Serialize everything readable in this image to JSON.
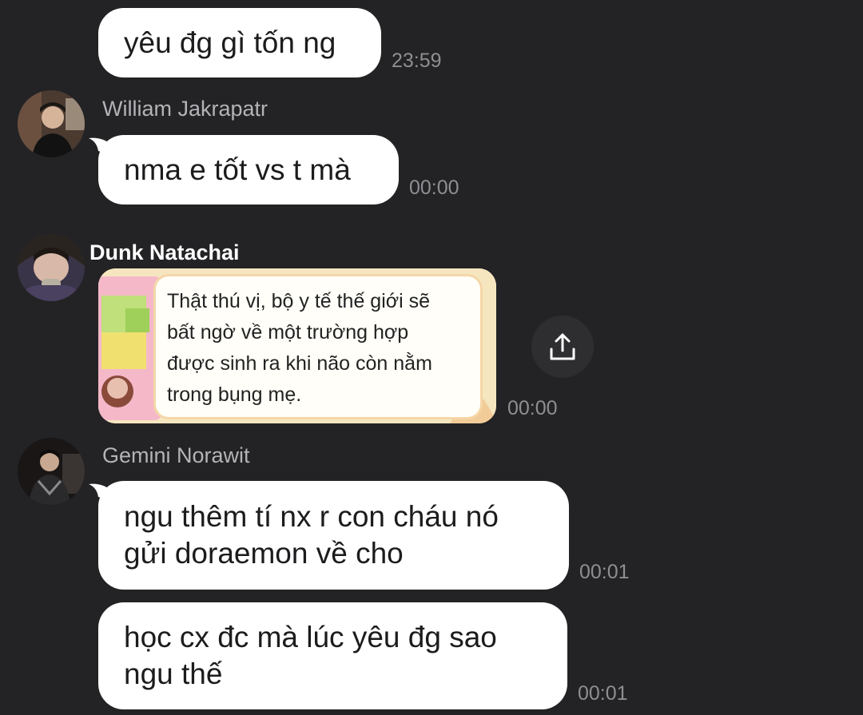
{
  "messages": [
    {
      "text_lines": [
        "yêu đg gì tốn ng"
      ],
      "time": "23:59"
    },
    {
      "sender": "William Jakrapatr",
      "avatar_icon": "user-photo-avatar",
      "text_lines": [
        "nma e tốt vs t mà"
      ],
      "time": "00:00"
    },
    {
      "sender": "Dunk Natachai",
      "avatar_icon": "user-photo-avatar",
      "image_caption_lines": [
        "Thật thú vị, bộ y tế thế giới sẽ",
        "bất ngờ về một trường hợp",
        "được sinh ra khi não còn nằm",
        "trong bụng mẹ."
      ],
      "time": "00:00",
      "share_icon": "share-upload-icon"
    },
    {
      "sender": "Gemini Norawit",
      "avatar_icon": "user-photo-avatar",
      "text_lines": [
        "ngu thêm tí nx r con cháu nó",
        "gửi doraemon về cho"
      ],
      "time": "00:01"
    },
    {
      "text_lines": [
        "học cx đc mà lúc yêu đg sao",
        "ngu thế"
      ],
      "time": "00:01"
    }
  ],
  "colors": {
    "background": "#232325",
    "bubble": "#ffffff",
    "timestamp": "#8e8e93"
  }
}
